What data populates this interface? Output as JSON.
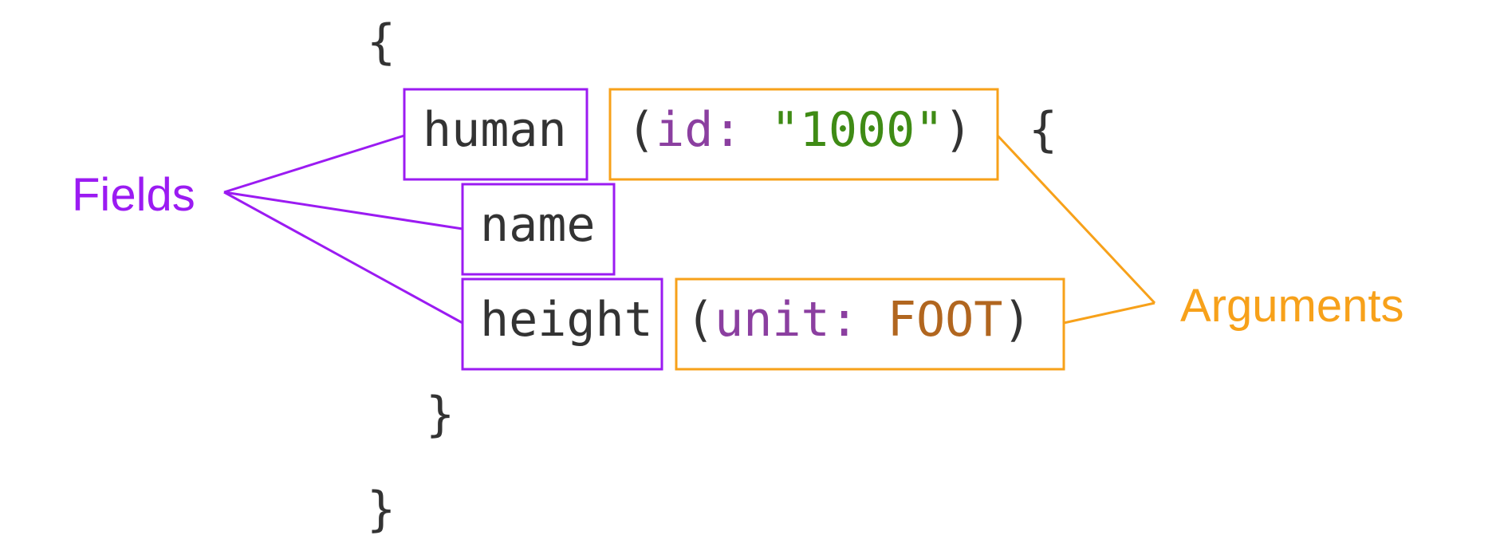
{
  "colors": {
    "field": "#9b1bf2",
    "argument": "#f7a11a",
    "code_text": "#333333",
    "arg_name": "#8b3fa0",
    "string_value": "#3f8b15",
    "enum_value": "#b1661f"
  },
  "code": {
    "open_brace": "{",
    "human": "human",
    "human_arg_open": "(",
    "human_arg_name": "id:",
    "human_arg_quote_open": "\"",
    "human_arg_value": "1000",
    "human_arg_quote_close": "\"",
    "human_arg_close": ")",
    "human_open_brace": "{",
    "name": "name",
    "height": "height",
    "height_arg_open": "(",
    "height_arg_name": "unit:",
    "height_arg_value": "FOOT",
    "height_arg_close": ")",
    "inner_close_brace": "}",
    "outer_close_brace": "}"
  },
  "labels": {
    "fields": "Fields",
    "arguments": "Arguments"
  }
}
